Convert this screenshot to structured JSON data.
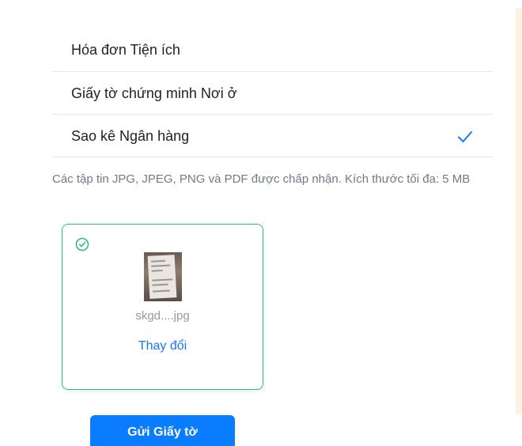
{
  "document_types": [
    {
      "label": "Hóa đơn Tiện ích",
      "selected": false
    },
    {
      "label": "Giấy tờ chứng minh Nơi ở",
      "selected": false
    },
    {
      "label": "Sao kê Ngân hàng",
      "selected": true
    }
  ],
  "hint_text": "Các tập tin JPG, JPEG, PNG và PDF được chấp nhận. Kích thước tối đa: 5 MB",
  "upload": {
    "file_name": "skgd....jpg",
    "change_label": "Thay đổi",
    "status_icon": "check-circle-icon"
  },
  "submit_label": "Gửi Giấy tờ",
  "colors": {
    "accent": "#0a7cff",
    "success": "#2ebd85",
    "link": "#1677ff",
    "checkmark": "#1677ff"
  }
}
